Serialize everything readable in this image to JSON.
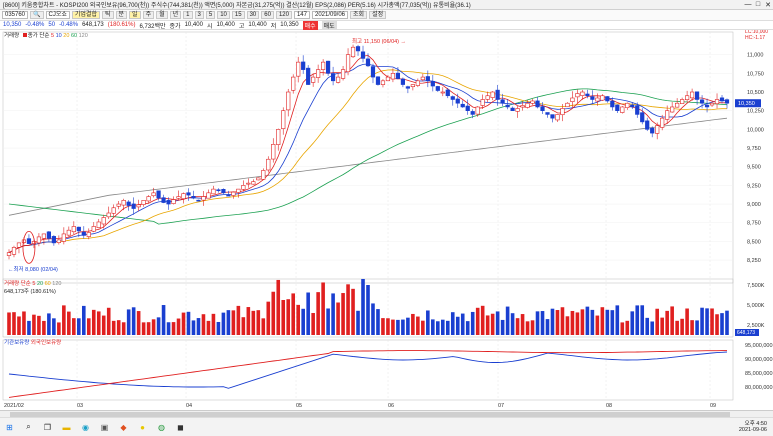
{
  "window": {
    "title": "[8600] 키움종합차트 - KOSPI200 외국인보유(96,700(천)) 주식수(744,381(천)) 액면(5,000) 자본금(31,275(억)) 결산(12월) EPS(2,086) PER(5.16) 시가총액(77,035(억)) 유통비율(36.1)",
    "controls": [
      "—",
      "□",
      "✕"
    ]
  },
  "toolbar": {
    "code": "035760",
    "name": "CJ오쇼",
    "mode_label": "기업결합",
    "periods": [
      "틱",
      "분",
      "일",
      "주",
      "월",
      "년"
    ],
    "minutes": [
      "1",
      "3",
      "5",
      "10",
      "15",
      "30",
      "60",
      "120"
    ],
    "count": "147",
    "date": "2021/09/06",
    "extra": [
      "조회",
      "설정"
    ]
  },
  "infobar": {
    "price": "10,350",
    "change": "-0.48%",
    "c1": "50",
    "c2": "-0.48%",
    "volume": "648,173",
    "vol_pct": "(180.61%)",
    "amount": "6,732백만",
    "label_close": "종가",
    "close": "10,400",
    "label_open": "시",
    "open": "10,400",
    "label_high": "고",
    "label_low": "저",
    "high": "10,400",
    "low": "10,350",
    "badge1": "매수",
    "badge2": "매도"
  },
  "price_legend": {
    "title": "거래량",
    "items": [
      {
        "label": "종가 단순",
        "color": "#e02020"
      },
      {
        "label": "5",
        "color": "#e02020"
      },
      {
        "label": "10",
        "color": "#1a3fd0"
      },
      {
        "label": "20",
        "color": "#e8a500"
      },
      {
        "label": "60",
        "color": "#1aa050"
      },
      {
        "label": "120",
        "color": "#888888"
      }
    ]
  },
  "volume_legend": {
    "title": "거래량",
    "line2": "648,173주 (180.61%)",
    "items": [
      {
        "label": "단순 5",
        "color": "#e02020"
      },
      {
        "label": "20",
        "color": "#1aa050"
      },
      {
        "label": "60",
        "color": "#e8a500"
      },
      {
        "label": "120",
        "color": "#888"
      }
    ]
  },
  "bottom_legend": {
    "items": [
      {
        "label": "기관보유량",
        "color": "#1a3fd0"
      },
      {
        "label": "외국인보유량",
        "color": "#e02020"
      }
    ]
  },
  "annotations": {
    "high": "최고 11,150 (06/04) →",
    "low": "←최저 8,080 (02/04)"
  },
  "price_axis": [
    "11,000",
    "10,750",
    "10,500",
    "10,250",
    "10,000",
    "9,750",
    "9,500",
    "9,250",
    "9,000",
    "8,750",
    "8,500",
    "8,250"
  ],
  "price_axis_top": [
    "LC:10,000",
    "HC:-1.17"
  ],
  "current_price_tag": "10,350",
  "volume_axis": [
    "7,500K",
    "5,000K",
    "2,500K"
  ],
  "volume_tag": "648,173",
  "bottom_axis": [
    "95,000,000",
    "90,000,000",
    "85,000,000",
    "80,000,000"
  ],
  "x_labels": [
    "2021/02",
    "03",
    "04",
    "05",
    "06",
    "07",
    "08",
    "09"
  ],
  "clock": {
    "time": "오후 4:50",
    "date": "2021-09-06"
  },
  "colors": {
    "up": "#e02020",
    "down": "#1a3fd0",
    "ma5": "#e02020",
    "ma10": "#1a3fd0",
    "ma20": "#e8a500",
    "ma60": "#1aa050",
    "ma120": "#888888"
  },
  "taskbar_icons": [
    "windows-icon",
    "search-icon",
    "task-view-icon",
    "file-explorer-icon",
    "edge-icon",
    "store-icon",
    "office-icon",
    "chat-icon",
    "chrome-icon",
    "app-icon"
  ],
  "chart_data": {
    "type": "candlestick",
    "x_range": [
      "2021/02",
      "2021/09"
    ],
    "ylim": [
      8000,
      11250
    ],
    "ohlc_close_series": [
      8350,
      8420,
      8480,
      8520,
      8470,
      8500,
      8560,
      8600,
      8540,
      8480,
      8520,
      8600,
      8650,
      8700,
      8640,
      8580,
      8620,
      8700,
      8760,
      8820,
      8880,
      8950,
      9000,
      9050,
      8980,
      8940,
      8990,
      9050,
      9100,
      9150,
      9080,
      9020,
      9000,
      9060,
      9100,
      9140,
      9120,
      9080,
      9050,
      9100,
      9150,
      9200,
      9180,
      9150,
      9120,
      9160,
      9200,
      9250,
      9280,
      9300,
      9350,
      9450,
      9600,
      9800,
      10000,
      10250,
      10500,
      10700,
      10900,
      10800,
      10600,
      10700,
      10800,
      10900,
      10750,
      10650,
      10700,
      10800,
      11000,
      11100,
      11050,
      10950,
      10850,
      10700,
      10600,
      10650,
      10700,
      10750,
      10680,
      10600,
      10550,
      10600,
      10650,
      10700,
      10650,
      10580,
      10520,
      10500,
      10450,
      10400,
      10350,
      10300,
      10250,
      10200,
      10300,
      10400,
      10450,
      10500,
      10400,
      10350,
      10300,
      10250,
      10280,
      10320,
      10350,
      10380,
      10300,
      10250,
      10200,
      10150,
      10200,
      10280,
      10350,
      10420,
      10480,
      10500,
      10450,
      10400,
      10420,
      10450,
      10380,
      10300,
      10250,
      10300,
      10350,
      10300,
      10200,
      10100,
      10000,
      9950,
      10050,
      10150,
      10250,
      10300,
      10350,
      10400,
      10450,
      10500,
      10400,
      10350,
      10300,
      10350,
      10400,
      10380,
      10350
    ]
  }
}
